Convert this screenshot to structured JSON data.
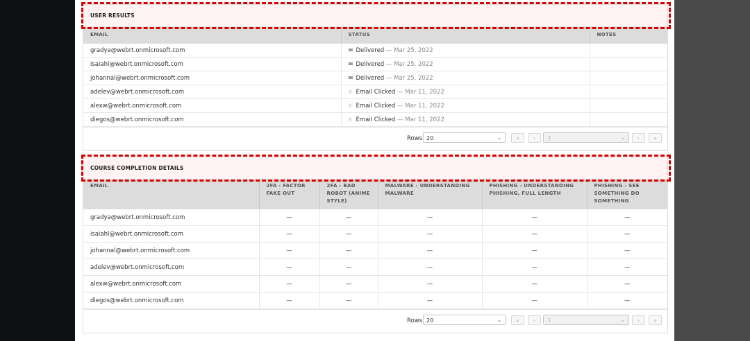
{
  "user_results": {
    "title": "USER RESULTS",
    "columns": [
      "EMAIL",
      "STATUS",
      "NOTES"
    ],
    "rows": [
      {
        "email": "gradya@webrt.onmicrosoft.com",
        "status": "Delivered",
        "date": "— Mar 25, 2022",
        "icon": "envelope-icon"
      },
      {
        "email": "isaiahl@webrt.onmicrosoft.com",
        "status": "Delivered",
        "date": "— Mar 25, 2022",
        "icon": "envelope-icon"
      },
      {
        "email": "johannal@webrt.onmicrosoft.com",
        "status": "Delivered",
        "date": "— Mar 25, 2022",
        "icon": "envelope-icon"
      },
      {
        "email": "adelev@webrt.onmicrosoft.com",
        "status": "Email Clicked",
        "date": "— Mar 11, 2022",
        "icon": "pointer-hand-icon"
      },
      {
        "email": "alexw@webrt.onmicrosoft.com",
        "status": "Email Clicked",
        "date": "— Mar 11, 2022",
        "icon": "pointer-hand-icon"
      },
      {
        "email": "diegos@webrt.onmicrosoft.com",
        "status": "Email Clicked",
        "date": "— Mar 11, 2022",
        "icon": "pointer-hand-icon"
      }
    ],
    "pager": {
      "rows_label": "Rows",
      "rows_value": "20",
      "page_value": "1"
    }
  },
  "course_completion": {
    "title": "COURSE COMPLETION DETAILS",
    "columns": [
      "EMAIL",
      "2FA - FACTOR FAKE OUT",
      "2FA - BAD ROBOT (ANIME STYLE)",
      "MALWARE - UNDERSTANDING MALWARE",
      "PHISHING - UNDERSTANDING PHISHING, FULL LENGTH",
      "PHISHING - SEE SOMETHING DO SOMETHING"
    ],
    "rows": [
      {
        "email": "gradya@webrt.onmicrosoft.com",
        "cells": [
          "—",
          "—",
          "—",
          "—",
          "—"
        ]
      },
      {
        "email": "isaiahl@webrt.onmicrosoft.com",
        "cells": [
          "—",
          "—",
          "—",
          "—",
          "—"
        ]
      },
      {
        "email": "johannal@webrt.onmicrosoft.com",
        "cells": [
          "—",
          "—",
          "—",
          "—",
          "—"
        ]
      },
      {
        "email": "adelev@webrt.onmicrosoft.com",
        "cells": [
          "—",
          "—",
          "—",
          "—",
          "—"
        ]
      },
      {
        "email": "alexw@webrt.onmicrosoft.com",
        "cells": [
          "—",
          "—",
          "—",
          "—",
          "—"
        ]
      },
      {
        "email": "diegos@webrt.onmicrosoft.com",
        "cells": [
          "—",
          "—",
          "—",
          "—",
          "—"
        ]
      }
    ],
    "pager": {
      "rows_label": "Rows",
      "rows_value": "20",
      "page_value": "1"
    }
  },
  "pager_icons": {
    "first": "«",
    "prev": "‹",
    "next": "›",
    "last": "»",
    "caret": "⌄"
  },
  "colors": {
    "highlight_dash": "#d60000",
    "header_tint": "#fff3f3"
  }
}
